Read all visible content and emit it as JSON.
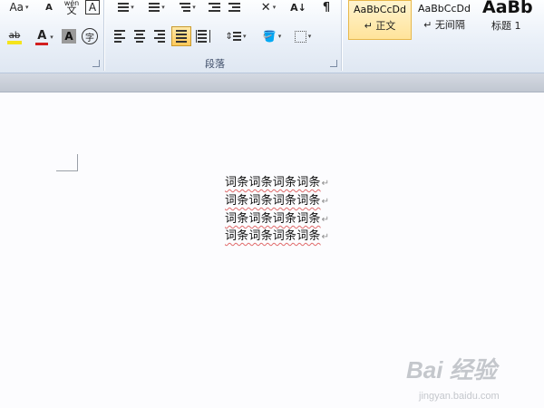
{
  "font_group": {
    "font_size_btn": "Aa",
    "phonetic_guide_label": "wén",
    "char_border_label": "A",
    "highlight_label": "ab",
    "font_color_label": "A",
    "char_shading_label": "A",
    "enclose_char_label": "字",
    "colors": {
      "highlight": "#f5e41c",
      "font_color": "#d21f1f"
    }
  },
  "paragraph_group": {
    "label": "段落",
    "active_alignment": "justify"
  },
  "styles_gallery": {
    "tiles": [
      {
        "sample": "AaBbCcDd",
        "name": "↵ 正文",
        "selected": true
      },
      {
        "sample": "AaBbCcDd",
        "name": "↵ 无间隔",
        "selected": false
      },
      {
        "sample": "AaBb",
        "name": "标题 1",
        "selected": false
      }
    ]
  },
  "document": {
    "lines": [
      "词条词条词条词条",
      "词条词条词条词条",
      "词条词条词条词条",
      "词条词条词条词条"
    ],
    "paragraph_mark": "↵"
  },
  "watermark": {
    "logo": "Bai 经验",
    "url": "jingyan.baidu.com"
  }
}
